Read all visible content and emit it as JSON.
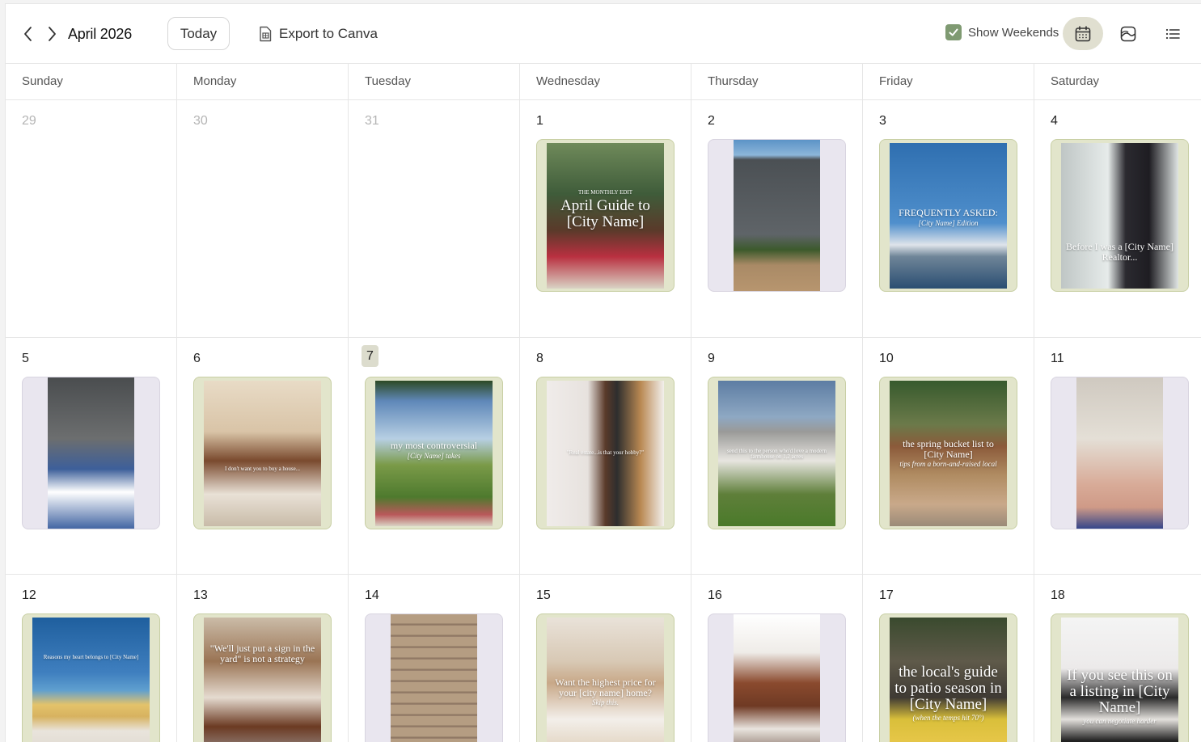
{
  "toolbar": {
    "month_title": "April 2026",
    "today_label": "Today",
    "export_label": "Export to Canva",
    "weekends_label": "Show Weekends",
    "weekends_checked": true,
    "accent_color": "#7f9a72",
    "active_view": "calendar",
    "icons": [
      "chevron-left-icon",
      "chevron-right-icon",
      "file-export-icon",
      "checkbox-check-icon",
      "calendar-view-icon",
      "grid-view-icon",
      "list-view-icon"
    ]
  },
  "weekdays": [
    "Sunday",
    "Monday",
    "Tuesday",
    "Wednesday",
    "Thursday",
    "Friday",
    "Saturday"
  ],
  "weeks": [
    [
      {
        "date": "29",
        "muted": true
      },
      {
        "date": "30",
        "muted": true
      },
      {
        "date": "31",
        "muted": true
      },
      {
        "date": "1",
        "post": {
          "style": "green",
          "scene": "market",
          "caption": "April Guide to [City Name]",
          "caption_top": "THE MONTHLY EDIT"
        }
      },
      {
        "date": "2",
        "post": {
          "style": "lilac",
          "scene": "house-gray",
          "caption": ""
        }
      },
      {
        "date": "3",
        "post": {
          "style": "green",
          "scene": "marina",
          "caption": "FREQUENTLY ASKED:",
          "subcaption": "[City Name] Edition"
        }
      },
      {
        "date": "4",
        "post": {
          "style": "green",
          "scene": "portrait-dark",
          "caption": "Before I was a [City Name] Realtor..."
        }
      }
    ],
    [
      {
        "date": "5",
        "post": {
          "style": "lilac",
          "scene": "picnic-blanket",
          "caption": ""
        }
      },
      {
        "date": "6",
        "post": {
          "style": "green",
          "scene": "portrait-couch",
          "caption": "I don't want you to buy a house..."
        }
      },
      {
        "date": "7",
        "today": true,
        "post": {
          "style": "green",
          "scene": "field",
          "caption": "my most controversial",
          "subcaption": "[City Name] takes"
        }
      },
      {
        "date": "8",
        "post": {
          "style": "green",
          "scene": "portrait-stairs",
          "caption": "\"Real estate...is that your hobby?\""
        }
      },
      {
        "date": "9",
        "post": {
          "style": "green",
          "scene": "house-white",
          "caption": "send this to the person who'd love a modern farmhouse on 1.2 acres"
        }
      },
      {
        "date": "10",
        "post": {
          "style": "green",
          "scene": "park-picnic",
          "caption": "the spring bucket list to [City Name]",
          "subcaption": "tips from a born-and-raised local"
        }
      },
      {
        "date": "11",
        "post": {
          "style": "lilac",
          "scene": "sand-feet",
          "caption": ""
        }
      }
    ],
    [
      {
        "date": "12",
        "post": {
          "style": "green",
          "scene": "beach",
          "caption": "Reasons my heart belongs to [City Name]"
        }
      },
      {
        "date": "13",
        "post": {
          "style": "green",
          "scene": "portrait-laptop",
          "caption": "\"We'll just put a sign in the yard\" is not a strategy"
        }
      },
      {
        "date": "14",
        "post": {
          "style": "lilac",
          "scene": "deck-shadow",
          "caption": ""
        }
      },
      {
        "date": "15",
        "post": {
          "style": "green",
          "scene": "writing",
          "caption": "Want the highest price for your [city name] home?",
          "subcaption": "Skip this."
        }
      },
      {
        "date": "16",
        "post": {
          "style": "lilac",
          "scene": "porch",
          "caption": ""
        }
      },
      {
        "date": "17",
        "post": {
          "style": "green",
          "scene": "patio",
          "caption": "the local's guide to patio season in [City Name]",
          "subcaption": "(when the temps hit 70°)"
        }
      },
      {
        "date": "18",
        "post": {
          "style": "green",
          "scene": "portrait-white",
          "caption": "If you see this on a listing in [City Name]",
          "subcaption": "you can negotiate harder"
        }
      }
    ]
  ]
}
